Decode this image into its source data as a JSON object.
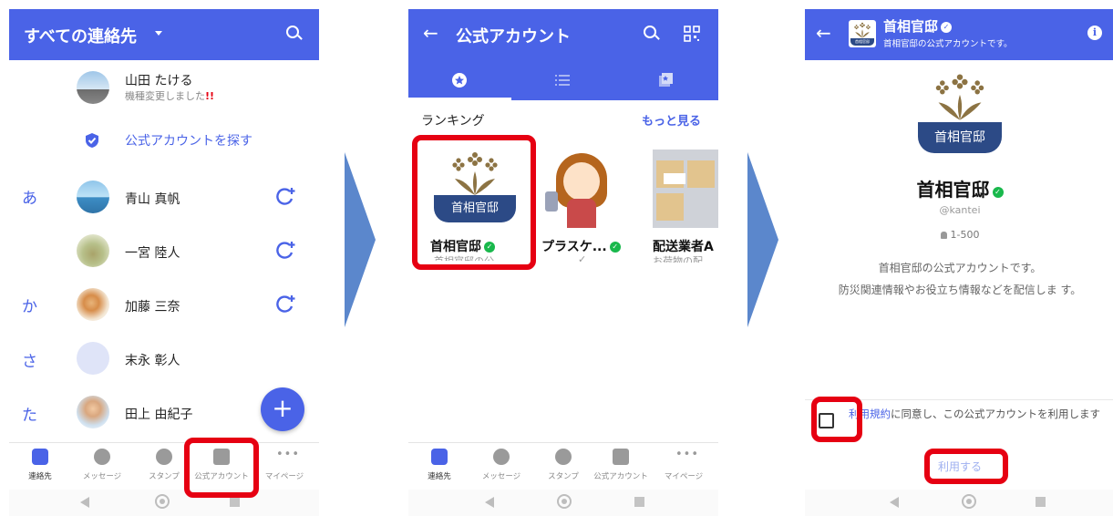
{
  "colors": {
    "brand": "#4a63e7",
    "highlight": "#e60012",
    "verified": "#19b84c",
    "arrow": "#5b87cc"
  },
  "nav": [
    {
      "label": "連絡先",
      "icon": "contacts-icon"
    },
    {
      "label": "メッセージ",
      "icon": "chat-bubble-icon"
    },
    {
      "label": "スタンプ",
      "icon": "smiley-icon"
    },
    {
      "label": "公式アカウント",
      "icon": "shield-check-icon"
    },
    {
      "label": "マイページ",
      "icon": "more-dots-icon"
    }
  ],
  "screen1": {
    "header_title": "すべての連絡先",
    "contacts": [
      {
        "name": "山田 たける",
        "status": "機種変更しました"
      },
      {
        "name": "青山 真帆"
      },
      {
        "name": "一宮 陸人"
      },
      {
        "name": "加藤 三奈"
      },
      {
        "name": "末永 彰人"
      },
      {
        "name": "田上 由紀子"
      }
    ],
    "find_official": "公式アカウントを探す",
    "alert_mark": "!!",
    "sections": [
      "あ",
      "か",
      "さ",
      "た"
    ],
    "fab_label": "+"
  },
  "screen2": {
    "header_title": "公式アカウント",
    "ranking_label": "ランキング",
    "more_label": "もっと見る",
    "cards": [
      {
        "name": "首相官邸",
        "sub": "首相官邸の公",
        "logo_text": "首相官邸"
      },
      {
        "name": "プラスケ...",
        "sub": "✓"
      },
      {
        "name": "配送業者A",
        "sub": "お荷物の配"
      }
    ]
  },
  "screen3": {
    "header_title": "首相官邸",
    "header_subtitle": "首相官邸の公式アカウントです。",
    "logo_text": "首相官邸",
    "header_logo_text": "首相官邸",
    "name": "首相官邸",
    "handle": "@kantei",
    "followers": "1-500",
    "description1": "首相官邸の公式アカウントです。",
    "description2": "防災関連情報やお役立ち情報などを配信しま す。",
    "terms_link": "利用規約",
    "terms_text": "に同意し、この公式アカウントを利用します",
    "use_button": "利用する"
  }
}
